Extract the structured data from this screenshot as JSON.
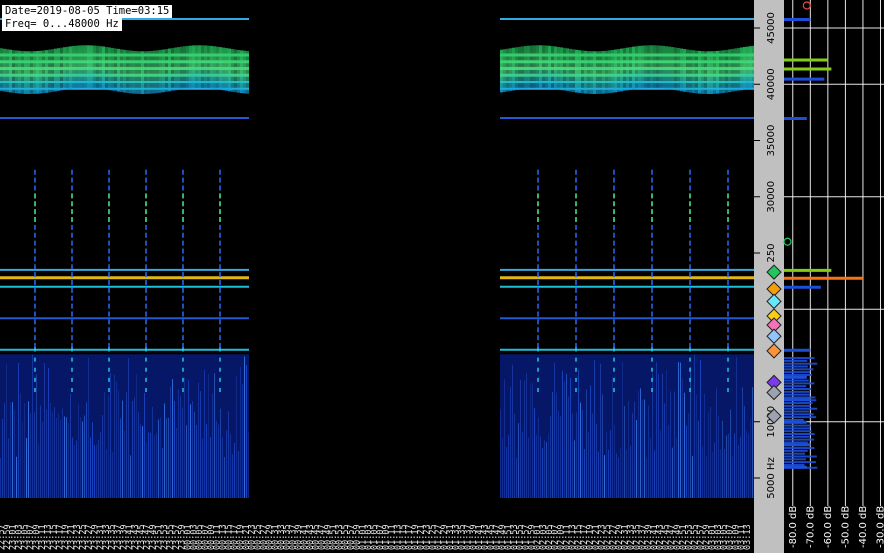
{
  "header": {
    "date_line": "Date=2019-08-05 Time=03:15",
    "freq_line": "Freq= 0...48000 Hz"
  },
  "chart_data": {
    "type": "heatmap",
    "title": "",
    "xlabel": "",
    "ylabel": "",
    "freq_range_hz": [
      0,
      48000
    ],
    "y_ticks": [
      {
        "value": 45000,
        "label": "45000"
      },
      {
        "value": 40000,
        "label": "40000"
      },
      {
        "value": 35000,
        "label": "35000"
      },
      {
        "value": 30000,
        "label": "30000"
      },
      {
        "value": 25000,
        "label": "250"
      },
      {
        "value": 10000,
        "label": "10000"
      },
      {
        "value": 5000,
        "label": "5000 Hz"
      }
    ],
    "gap_region_columns": [
      0.33,
      0.66
    ],
    "bands": [
      {
        "freq_hz": 45800,
        "level": 0.35
      },
      {
        "freq_hz": 42600,
        "level": 0.75
      },
      {
        "freq_hz": 42000,
        "level": 0.8
      },
      {
        "freq_hz": 41400,
        "level": 0.8
      },
      {
        "freq_hz": 40800,
        "level": 0.75
      },
      {
        "freq_hz": 40200,
        "level": 0.6
      },
      {
        "freq_hz": 39600,
        "level": 0.4
      },
      {
        "freq_hz": 37000,
        "level": 0.3
      },
      {
        "freq_hz": 23500,
        "level": 0.5
      },
      {
        "freq_hz": 22800,
        "level": 0.95
      },
      {
        "freq_hz": 22000,
        "level": 0.6
      },
      {
        "freq_hz": 19200,
        "level": 0.25
      },
      {
        "freq_hz": 16400,
        "level": 0.55
      }
    ],
    "pulse_freq_range_hz": [
      17000,
      33000
    ],
    "noise_floor_freq_range_hz": [
      0,
      16000
    ],
    "x_tick_labels": [
      "22:57",
      "22:59",
      "23:01",
      "23:03",
      "23:05",
      "23:07",
      "23:09",
      "23:11",
      "23:13",
      "23:15",
      "23:17",
      "23:19",
      "23:21",
      "23:23",
      "23:25",
      "23:27",
      "23:29",
      "23:31",
      "23:33",
      "23:35",
      "23:37",
      "23:39",
      "23:41",
      "23:43",
      "23:45",
      "23:47",
      "23:49",
      "23:51",
      "23:53",
      "23:55",
      "23:57",
      "23:59",
      "00:01",
      "00:03",
      "00:05",
      "00:07",
      "00:09",
      "00:11",
      "00:13",
      "00:15",
      "00:17",
      "00:19",
      "00:21",
      "00:23",
      "00:25",
      "00:27",
      "00:29",
      "00:31",
      "00:33",
      "00:35",
      "00:37",
      "00:39",
      "00:41",
      "00:43",
      "00:45",
      "00:47",
      "00:49",
      "00:51",
      "00:53",
      "00:55",
      "00:57",
      "00:59",
      "01:01",
      "01:03",
      "01:05",
      "01:07",
      "01:09",
      "01:11",
      "01:13",
      "01:15",
      "01:17",
      "01:19",
      "01:21",
      "01:23",
      "01:25",
      "01:27",
      "01:29",
      "01:31",
      "01:33",
      "01:35",
      "01:37",
      "01:39",
      "01:41",
      "01:43",
      "01:45",
      "01:47",
      "01:49",
      "01:51",
      "01:53",
      "01:55",
      "01:57",
      "01:59",
      "02:01",
      "02:03",
      "02:05",
      "02:07",
      "02:09",
      "02:11",
      "02:13",
      "02:15",
      "02:17",
      "02:19",
      "02:21",
      "02:23",
      "02:25",
      "02:27",
      "02:29",
      "02:31",
      "02:33",
      "02:35",
      "02:37",
      "02:39",
      "02:41",
      "02:43",
      "02:45",
      "02:47",
      "02:49",
      "02:51",
      "02:53",
      "02:55",
      "02:57",
      "02:59",
      "03:01",
      "03:03",
      "03:05",
      "03:07",
      "03:09",
      "03:11",
      "03:13"
    ],
    "db_axis": {
      "ticks": [
        {
          "value": -80,
          "label": "-80.0 dB"
        },
        {
          "value": -70,
          "label": "-70.0 dB"
        },
        {
          "value": -60,
          "label": "-60.0 dB"
        },
        {
          "value": -50,
          "label": "-50.0 dB"
        },
        {
          "value": -40,
          "label": "-40.0 dB"
        },
        {
          "value": -30,
          "label": "-30.0 dB"
        }
      ],
      "range_db": [
        -85,
        -28
      ]
    },
    "spectrum_profile": [
      {
        "freq_hz": 45800,
        "db": -70
      },
      {
        "freq_hz": 42200,
        "db": -60
      },
      {
        "freq_hz": 41400,
        "db": -58
      },
      {
        "freq_hz": 40500,
        "db": -62
      },
      {
        "freq_hz": 37000,
        "db": -72
      },
      {
        "freq_hz": 23500,
        "db": -58
      },
      {
        "freq_hz": 22800,
        "db": -40
      },
      {
        "freq_hz": 22000,
        "db": -64
      },
      {
        "freq_hz": 16400,
        "db": -70
      },
      {
        "freq_hz": 14000,
        "db": -72
      },
      {
        "freq_hz": 12000,
        "db": -70
      },
      {
        "freq_hz": 10000,
        "db": -72
      },
      {
        "freq_hz": 8000,
        "db": -70
      },
      {
        "freq_hz": 6000,
        "db": -72
      }
    ],
    "markers": [
      {
        "freq_hz": 23300,
        "color": "#22c55e"
      },
      {
        "freq_hz": 21800,
        "color": "#f59e0b"
      },
      {
        "freq_hz": 20700,
        "color": "#67e8f9"
      },
      {
        "freq_hz": 19400,
        "color": "#facc15"
      },
      {
        "freq_hz": 18600,
        "color": "#f472b6"
      },
      {
        "freq_hz": 17600,
        "color": "#93c5fd"
      },
      {
        "freq_hz": 16300,
        "color": "#fb923c"
      },
      {
        "freq_hz": 13500,
        "color": "#7c3aed"
      },
      {
        "freq_hz": 12600,
        "color": "#9ca3af"
      },
      {
        "freq_hz": 10500,
        "color": "#9ca3af"
      }
    ],
    "peak_markers": [
      {
        "freq_hz": 47000,
        "db": -72,
        "color": "#ef4444"
      },
      {
        "freq_hz": 26000,
        "db": -83,
        "color": "#22c55e"
      }
    ],
    "colors": {
      "background": "#000000",
      "axis_strip": "#c0c0c0",
      "grid": "#ffffff",
      "spectrum": "#1d4ed8"
    }
  }
}
